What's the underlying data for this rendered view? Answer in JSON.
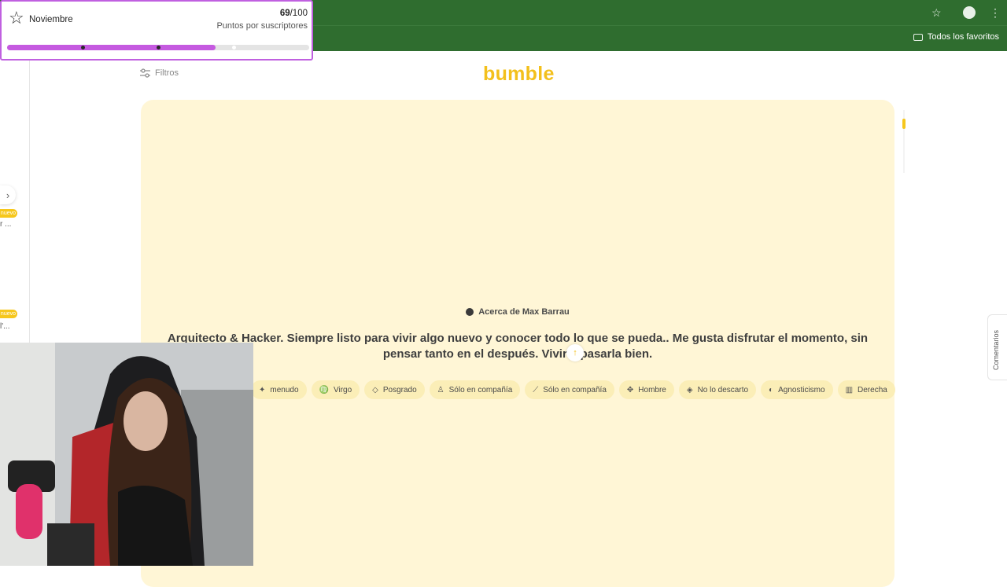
{
  "browser": {
    "toolbar_icons": [
      "star-icon",
      "profile-avatar-icon",
      "kebab-menu-icon"
    ],
    "bookmarks_folder": "Todos los favoritos"
  },
  "app": {
    "logo": "bumble",
    "filters_label": "Filtros",
    "sidebar_badges": [
      "nuevo",
      "nuevo"
    ],
    "sidebar_peeks": [
      "r ...",
      "l'..."
    ]
  },
  "profile": {
    "about_title": "Acerca de Max Barrau",
    "bio": "Arquitecto & Hacker. Siempre listo para vivir algo nuevo y conocer todo lo que se pueda.. Me gusta disfrutar el momento, sin pensar tanto en el después. Vivir y pasarla bien.",
    "tags": [
      {
        "icon": "dumbbell-icon",
        "label": "menudo"
      },
      {
        "icon": "zodiac-icon",
        "label": "Virgo"
      },
      {
        "icon": "graduation-cap-icon",
        "label": "Posgrado"
      },
      {
        "icon": "glass-icon",
        "label": "Sólo en compañía"
      },
      {
        "icon": "cigarette-icon",
        "label": "Sólo en compañía"
      },
      {
        "icon": "baby-icon",
        "label": "Hombre"
      },
      {
        "icon": "tag-icon",
        "label": "No lo descarto"
      },
      {
        "icon": "religion-icon",
        "label": "Agnosticismo"
      },
      {
        "icon": "politics-icon",
        "label": "Derecha"
      }
    ]
  },
  "comments_tab": "Comentarios",
  "sub_goal": {
    "month": "Noviembre",
    "current": "69",
    "total": "/100",
    "label": "Puntos por suscriptores",
    "progress": 0.69,
    "marker_fractions": [
      0.25,
      0.5,
      0.75
    ],
    "accent_color": "#c55ae0"
  }
}
